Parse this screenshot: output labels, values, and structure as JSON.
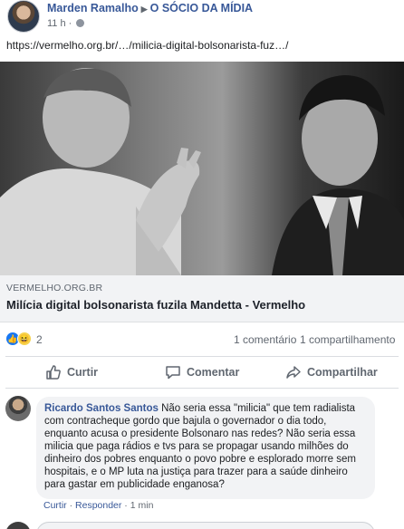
{
  "post": {
    "author": "Marden Ramalho",
    "target": "O SÓCIO DA MÍDIA",
    "time": "11 h",
    "link_text": "https://vermelho.org.br/…/milicia-digital-bolsonarista-fuz…/"
  },
  "link_preview": {
    "domain": "VERMELHO.ORG.BR",
    "title": "Milícia digital bolsonarista fuzila Mandetta - Vermelho"
  },
  "stats": {
    "reaction_count": "2",
    "comments": "1 comentário",
    "shares": "1 compartilhamento"
  },
  "actions": {
    "like": "Curtir",
    "comment": "Comentar",
    "share": "Compartilhar"
  },
  "comment": {
    "author": "Ricardo Santos Santos",
    "text": "Não seria essa \"milicia\" que tem radialista com contracheque gordo que bajula o governador o dia todo, enquanto acusa o presidente Bolsonaro nas redes? Não seria essa milicia que paga rádios e tvs para se propagar usando milhões do dinheiro dos pobres enquanto o povo pobre e esplorado morre sem hospitais, e o MP luta na justiça para trazer para a saúde dinheiro para gastar em publicidade enganosa?",
    "like": "Curtir",
    "reply": "Responder",
    "time": "1 min"
  }
}
